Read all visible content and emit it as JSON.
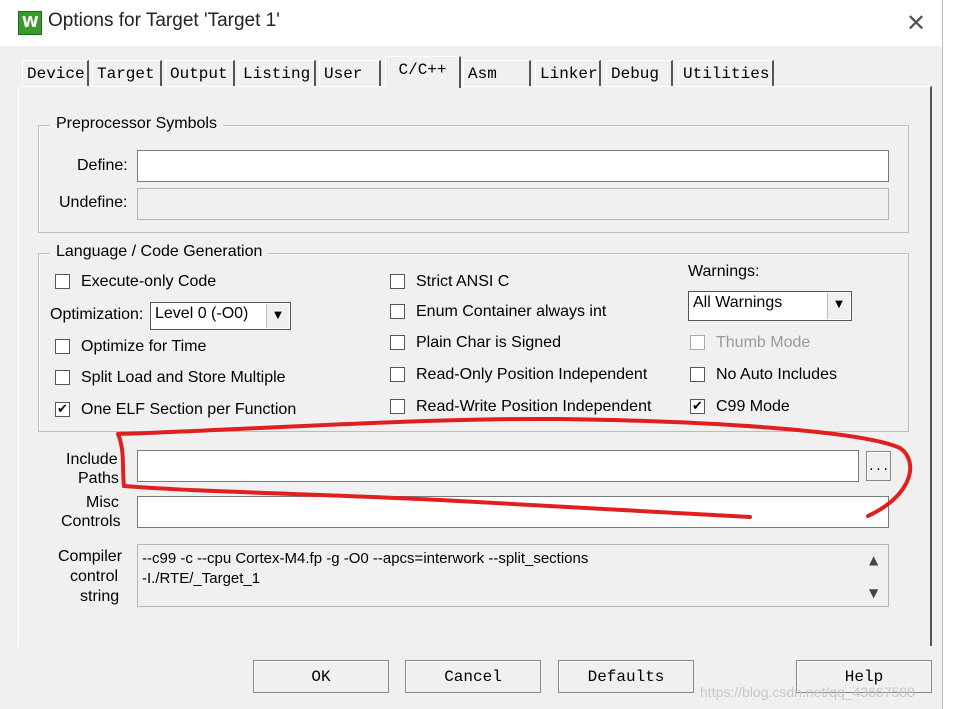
{
  "window": {
    "title": "Options for Target 'Target 1'",
    "close_glyph": "✕",
    "app_icon": "keil-uvision-icon",
    "app_icon_glyph": "W"
  },
  "tabs": [
    {
      "label": "Device"
    },
    {
      "label": "Target"
    },
    {
      "label": "Output"
    },
    {
      "label": "Listing"
    },
    {
      "label": "User"
    },
    {
      "label": "C/C++"
    },
    {
      "label": "Asm"
    },
    {
      "label": "Linker"
    },
    {
      "label": "Debug"
    },
    {
      "label": "Utilities"
    }
  ],
  "active_tab": "C/C++",
  "preprocessor": {
    "group_label": "Preprocessor Symbols",
    "define_label": "Define:",
    "define_value": "",
    "undefine_label": "Undefine:",
    "undefine_value": ""
  },
  "language": {
    "group_label": "Language / Code Generation",
    "execute_only": {
      "label": "Execute-only Code",
      "checked": false
    },
    "optimization_label": "Optimization:",
    "optimization_value": "Level 0 (-O0)",
    "optimize_time": {
      "label": "Optimize for Time",
      "checked": false
    },
    "split_load": {
      "label": "Split Load and Store Multiple",
      "checked": false
    },
    "one_elf": {
      "label": "One ELF Section per Function",
      "checked": true
    },
    "strict_ansi": {
      "label": "Strict ANSI C",
      "checked": false
    },
    "enum_container": {
      "label": "Enum Container always int",
      "checked": false
    },
    "plain_char": {
      "label": "Plain Char is Signed",
      "checked": false
    },
    "ro_position": {
      "label": "Read-Only Position Independent",
      "checked": false
    },
    "rw_position": {
      "label": "Read-Write Position Independent",
      "checked": false
    },
    "warnings_label": "Warnings:",
    "warnings_value": "All Warnings",
    "thumb_mode": {
      "label": "Thumb Mode",
      "checked": false,
      "enabled": false
    },
    "no_auto_includes": {
      "label": "No Auto Includes",
      "checked": false
    },
    "c99_mode": {
      "label": "C99 Mode",
      "checked": true
    }
  },
  "include_paths": {
    "label_line1": "Include",
    "label_line2": "Paths",
    "value": "",
    "browse_label": "..."
  },
  "misc_controls": {
    "label_line1": "Misc",
    "label_line2": "Controls",
    "value": ""
  },
  "compiler_string": {
    "label_line1": "Compiler",
    "label_line2": "control",
    "label_line3": "string",
    "line1": "--c99 -c --cpu Cortex-M4.fp -g -O0 --apcs=interwork --split_sections",
    "line2": "-I./RTE/_Target_1",
    "scroll_up": "▲",
    "scroll_down": "▼"
  },
  "buttons": {
    "ok": "OK",
    "cancel": "Cancel",
    "defaults": "Defaults",
    "help": "Help"
  },
  "watermark": "https://blog.csdn.net/qq_43667588",
  "annotation_color": "#e02020",
  "check_glyph": "✔"
}
